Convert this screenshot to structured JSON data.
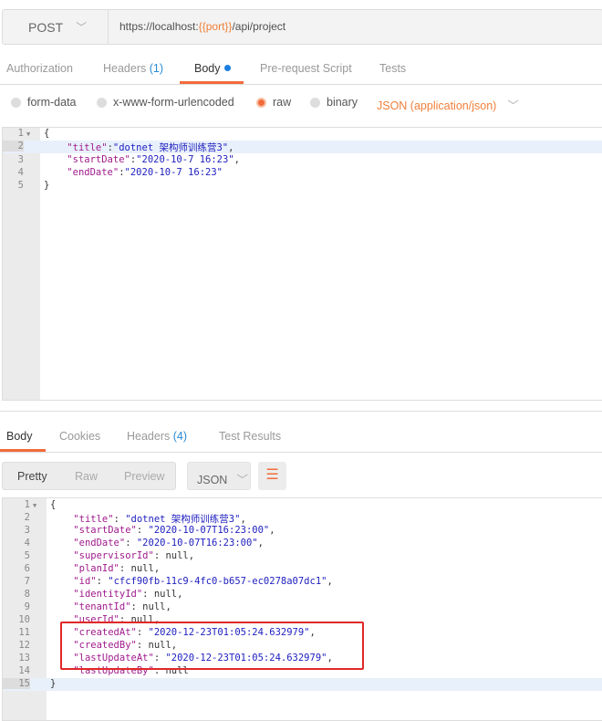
{
  "request": {
    "method": "POST",
    "url_prefix": "https://localhost:",
    "url_var": "{{port}}",
    "url_suffix": "/api/project"
  },
  "request_tabs": [
    {
      "label": "Authorization"
    },
    {
      "label": "Headers",
      "count": "(1)"
    },
    {
      "label": "Body"
    },
    {
      "label": "Pre-request Script"
    },
    {
      "label": "Tests"
    }
  ],
  "body_modes": [
    {
      "label": "form-data",
      "selected": false
    },
    {
      "label": "x-www-form-urlencoded",
      "selected": false
    },
    {
      "label": "raw",
      "selected": true
    },
    {
      "label": "binary",
      "selected": false
    }
  ],
  "content_type": "JSON (application/json)",
  "request_body": [
    [
      [
        "p",
        "{"
      ]
    ],
    [
      [
        "p",
        "    "
      ],
      [
        "k",
        "\"title\""
      ],
      [
        "p",
        ":"
      ],
      [
        "s",
        "\"dotnet 架构师训练营3\""
      ],
      [
        "p",
        ","
      ]
    ],
    [
      [
        "p",
        "    "
      ],
      [
        "k",
        "\"startDate\""
      ],
      [
        "p",
        ":"
      ],
      [
        "s",
        "\"2020-10-7 16:23\""
      ],
      [
        "p",
        ","
      ]
    ],
    [
      [
        "p",
        "    "
      ],
      [
        "k",
        "\"endDate\""
      ],
      [
        "p",
        ":"
      ],
      [
        "s",
        "\"2020-10-7 16:23\""
      ]
    ],
    [
      [
        "p",
        "}"
      ]
    ]
  ],
  "response_tabs": [
    {
      "label": "Body"
    },
    {
      "label": "Cookies"
    },
    {
      "label": "Headers",
      "count": "(4)"
    },
    {
      "label": "Test Results"
    }
  ],
  "view_modes": [
    "Pretty",
    "Raw",
    "Preview"
  ],
  "format": "JSON",
  "response_body": [
    [
      [
        "p",
        "{"
      ]
    ],
    [
      [
        "p",
        "    "
      ],
      [
        "k",
        "\"title\""
      ],
      [
        "p",
        ": "
      ],
      [
        "s",
        "\"dotnet 架构师训练营3\""
      ],
      [
        "p",
        ","
      ]
    ],
    [
      [
        "p",
        "    "
      ],
      [
        "k",
        "\"startDate\""
      ],
      [
        "p",
        ": "
      ],
      [
        "s",
        "\"2020-10-07T16:23:00\""
      ],
      [
        "p",
        ","
      ]
    ],
    [
      [
        "p",
        "    "
      ],
      [
        "k",
        "\"endDate\""
      ],
      [
        "p",
        ": "
      ],
      [
        "s",
        "\"2020-10-07T16:23:00\""
      ],
      [
        "p",
        ","
      ]
    ],
    [
      [
        "p",
        "    "
      ],
      [
        "k",
        "\"supervisorId\""
      ],
      [
        "p",
        ": "
      ],
      [
        "n",
        "null"
      ],
      [
        "p",
        ","
      ]
    ],
    [
      [
        "p",
        "    "
      ],
      [
        "k",
        "\"planId\""
      ],
      [
        "p",
        ": "
      ],
      [
        "n",
        "null"
      ],
      [
        "p",
        ","
      ]
    ],
    [
      [
        "p",
        "    "
      ],
      [
        "k",
        "\"id\""
      ],
      [
        "p",
        ": "
      ],
      [
        "s",
        "\"cfcf90fb-11c9-4fc0-b657-ec0278a07dc1\""
      ],
      [
        "p",
        ","
      ]
    ],
    [
      [
        "p",
        "    "
      ],
      [
        "k",
        "\"identityId\""
      ],
      [
        "p",
        ": "
      ],
      [
        "n",
        "null"
      ],
      [
        "p",
        ","
      ]
    ],
    [
      [
        "p",
        "    "
      ],
      [
        "k",
        "\"tenantId\""
      ],
      [
        "p",
        ": "
      ],
      [
        "n",
        "null"
      ],
      [
        "p",
        ","
      ]
    ],
    [
      [
        "p",
        "    "
      ],
      [
        "k",
        "\"userId\""
      ],
      [
        "p",
        ": "
      ],
      [
        "n",
        "null"
      ],
      [
        "p",
        ","
      ]
    ],
    [
      [
        "p",
        "    "
      ],
      [
        "k",
        "\"createdAt\""
      ],
      [
        "p",
        ": "
      ],
      [
        "s",
        "\"2020-12-23T01:05:24.632979\""
      ],
      [
        "p",
        ","
      ]
    ],
    [
      [
        "p",
        "    "
      ],
      [
        "k",
        "\"createdBy\""
      ],
      [
        "p",
        ": "
      ],
      [
        "n",
        "null"
      ],
      [
        "p",
        ","
      ]
    ],
    [
      [
        "p",
        "    "
      ],
      [
        "k",
        "\"lastUpdateAt\""
      ],
      [
        "p",
        ": "
      ],
      [
        "s",
        "\"2020-12-23T01:05:24.632979\""
      ],
      [
        "p",
        ","
      ]
    ],
    [
      [
        "p",
        "    "
      ],
      [
        "k",
        "\"lastUpdateBy\""
      ],
      [
        "p",
        ": "
      ],
      [
        "n",
        "null"
      ]
    ],
    [
      [
        "p",
        "}"
      ]
    ]
  ],
  "colors": {
    "accent": "#f26b3a",
    "highlight_box": "#e02828",
    "link": "#2a8ad4"
  }
}
